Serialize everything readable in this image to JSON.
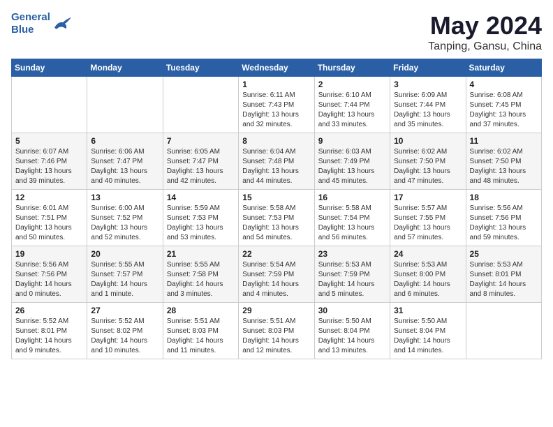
{
  "header": {
    "logo_line1": "General",
    "logo_line2": "Blue",
    "title": "May 2024",
    "subtitle": "Tanping, Gansu, China"
  },
  "weekdays": [
    "Sunday",
    "Monday",
    "Tuesday",
    "Wednesday",
    "Thursday",
    "Friday",
    "Saturday"
  ],
  "weeks": [
    [
      {
        "day": "",
        "info": ""
      },
      {
        "day": "",
        "info": ""
      },
      {
        "day": "",
        "info": ""
      },
      {
        "day": "1",
        "info": "Sunrise: 6:11 AM\nSunset: 7:43 PM\nDaylight: 13 hours\nand 32 minutes."
      },
      {
        "day": "2",
        "info": "Sunrise: 6:10 AM\nSunset: 7:44 PM\nDaylight: 13 hours\nand 33 minutes."
      },
      {
        "day": "3",
        "info": "Sunrise: 6:09 AM\nSunset: 7:44 PM\nDaylight: 13 hours\nand 35 minutes."
      },
      {
        "day": "4",
        "info": "Sunrise: 6:08 AM\nSunset: 7:45 PM\nDaylight: 13 hours\nand 37 minutes."
      }
    ],
    [
      {
        "day": "5",
        "info": "Sunrise: 6:07 AM\nSunset: 7:46 PM\nDaylight: 13 hours\nand 39 minutes."
      },
      {
        "day": "6",
        "info": "Sunrise: 6:06 AM\nSunset: 7:47 PM\nDaylight: 13 hours\nand 40 minutes."
      },
      {
        "day": "7",
        "info": "Sunrise: 6:05 AM\nSunset: 7:47 PM\nDaylight: 13 hours\nand 42 minutes."
      },
      {
        "day": "8",
        "info": "Sunrise: 6:04 AM\nSunset: 7:48 PM\nDaylight: 13 hours\nand 44 minutes."
      },
      {
        "day": "9",
        "info": "Sunrise: 6:03 AM\nSunset: 7:49 PM\nDaylight: 13 hours\nand 45 minutes."
      },
      {
        "day": "10",
        "info": "Sunrise: 6:02 AM\nSunset: 7:50 PM\nDaylight: 13 hours\nand 47 minutes."
      },
      {
        "day": "11",
        "info": "Sunrise: 6:02 AM\nSunset: 7:50 PM\nDaylight: 13 hours\nand 48 minutes."
      }
    ],
    [
      {
        "day": "12",
        "info": "Sunrise: 6:01 AM\nSunset: 7:51 PM\nDaylight: 13 hours\nand 50 minutes."
      },
      {
        "day": "13",
        "info": "Sunrise: 6:00 AM\nSunset: 7:52 PM\nDaylight: 13 hours\nand 52 minutes."
      },
      {
        "day": "14",
        "info": "Sunrise: 5:59 AM\nSunset: 7:53 PM\nDaylight: 13 hours\nand 53 minutes."
      },
      {
        "day": "15",
        "info": "Sunrise: 5:58 AM\nSunset: 7:53 PM\nDaylight: 13 hours\nand 54 minutes."
      },
      {
        "day": "16",
        "info": "Sunrise: 5:58 AM\nSunset: 7:54 PM\nDaylight: 13 hours\nand 56 minutes."
      },
      {
        "day": "17",
        "info": "Sunrise: 5:57 AM\nSunset: 7:55 PM\nDaylight: 13 hours\nand 57 minutes."
      },
      {
        "day": "18",
        "info": "Sunrise: 5:56 AM\nSunset: 7:56 PM\nDaylight: 13 hours\nand 59 minutes."
      }
    ],
    [
      {
        "day": "19",
        "info": "Sunrise: 5:56 AM\nSunset: 7:56 PM\nDaylight: 14 hours\nand 0 minutes."
      },
      {
        "day": "20",
        "info": "Sunrise: 5:55 AM\nSunset: 7:57 PM\nDaylight: 14 hours\nand 1 minute."
      },
      {
        "day": "21",
        "info": "Sunrise: 5:55 AM\nSunset: 7:58 PM\nDaylight: 14 hours\nand 3 minutes."
      },
      {
        "day": "22",
        "info": "Sunrise: 5:54 AM\nSunset: 7:59 PM\nDaylight: 14 hours\nand 4 minutes."
      },
      {
        "day": "23",
        "info": "Sunrise: 5:53 AM\nSunset: 7:59 PM\nDaylight: 14 hours\nand 5 minutes."
      },
      {
        "day": "24",
        "info": "Sunrise: 5:53 AM\nSunset: 8:00 PM\nDaylight: 14 hours\nand 6 minutes."
      },
      {
        "day": "25",
        "info": "Sunrise: 5:53 AM\nSunset: 8:01 PM\nDaylight: 14 hours\nand 8 minutes."
      }
    ],
    [
      {
        "day": "26",
        "info": "Sunrise: 5:52 AM\nSunset: 8:01 PM\nDaylight: 14 hours\nand 9 minutes."
      },
      {
        "day": "27",
        "info": "Sunrise: 5:52 AM\nSunset: 8:02 PM\nDaylight: 14 hours\nand 10 minutes."
      },
      {
        "day": "28",
        "info": "Sunrise: 5:51 AM\nSunset: 8:03 PM\nDaylight: 14 hours\nand 11 minutes."
      },
      {
        "day": "29",
        "info": "Sunrise: 5:51 AM\nSunset: 8:03 PM\nDaylight: 14 hours\nand 12 minutes."
      },
      {
        "day": "30",
        "info": "Sunrise: 5:50 AM\nSunset: 8:04 PM\nDaylight: 14 hours\nand 13 minutes."
      },
      {
        "day": "31",
        "info": "Sunrise: 5:50 AM\nSunset: 8:04 PM\nDaylight: 14 hours\nand 14 minutes."
      },
      {
        "day": "",
        "info": ""
      }
    ]
  ]
}
